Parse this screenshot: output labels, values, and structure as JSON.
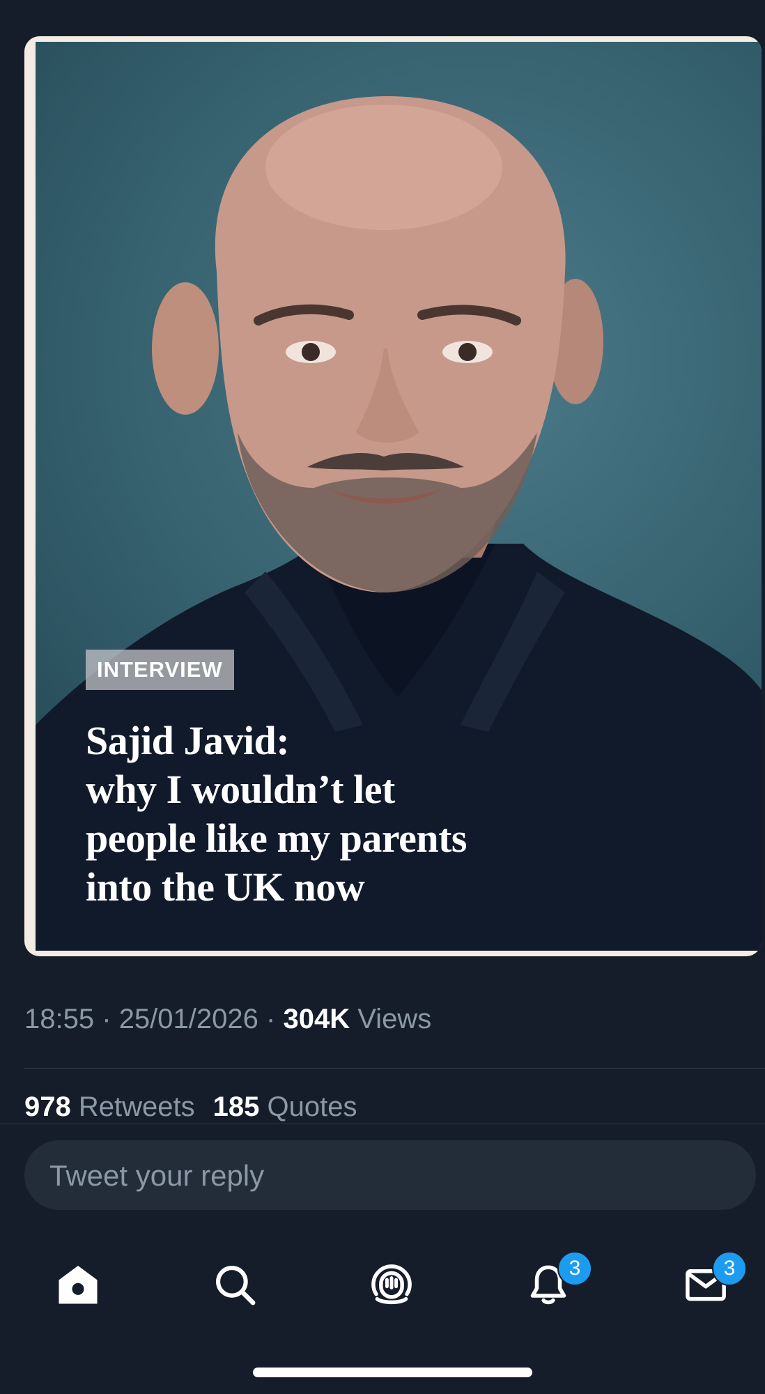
{
  "media": {
    "tag": "INTERVIEW",
    "headline_lines": [
      "Sajid Javid:",
      "why I wouldn’t let",
      "people like my parents",
      "into the UK now"
    ]
  },
  "meta": {
    "time": "18:55",
    "separator": "·",
    "date": "25/01/2026",
    "views_count": "304K",
    "views_label": "Views"
  },
  "stats": {
    "retweets_count": "978",
    "retweets_label": "Retweets",
    "quotes_count": "185",
    "quotes_label": "Quotes"
  },
  "reply": {
    "placeholder": "Tweet your reply"
  },
  "tabbar": {
    "notifications_badge": "3",
    "messages_badge": "3"
  },
  "colors": {
    "background": "#151d2a",
    "muted_text": "#8b98a5",
    "accent": "#1d9bf0"
  }
}
